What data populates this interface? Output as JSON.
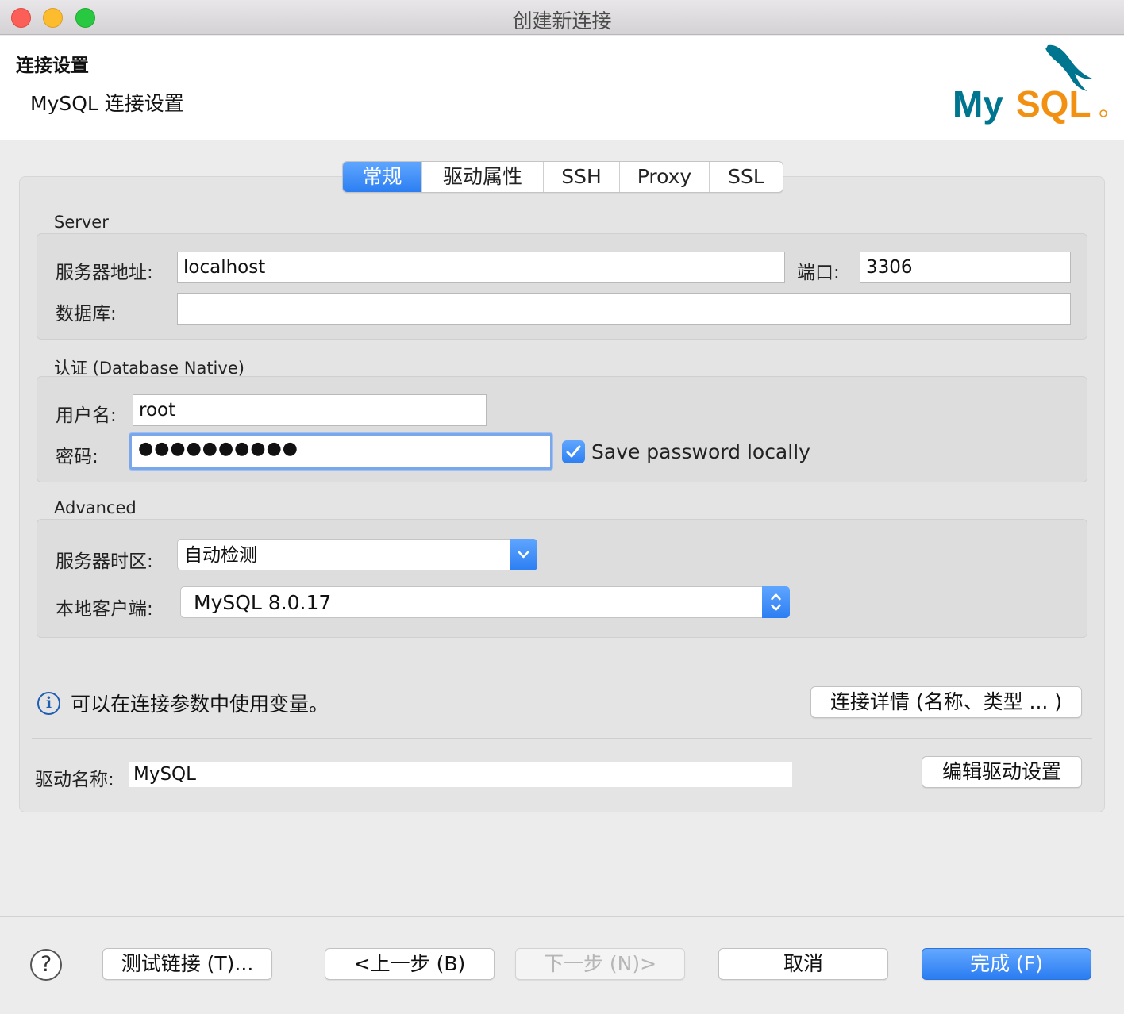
{
  "window": {
    "title": "创建新连接"
  },
  "header": {
    "title": "连接设置",
    "subtitle": "MySQL 连接设置",
    "logo": "MySQL"
  },
  "tabs": [
    {
      "label": "常规",
      "active": true
    },
    {
      "label": "驱动属性",
      "active": false
    },
    {
      "label": "SSH",
      "active": false
    },
    {
      "label": "Proxy",
      "active": false
    },
    {
      "label": "SSL",
      "active": false
    }
  ],
  "server": {
    "section": "Server",
    "host_label": "服务器地址:",
    "host_value": "localhost",
    "port_label": "端口:",
    "port_value": "3306",
    "database_label": "数据库:",
    "database_value": ""
  },
  "auth": {
    "section": "认证 (Database Native)",
    "user_label": "用户名:",
    "user_value": "root",
    "password_label": "密码:",
    "password_value": "●●●●●●●●●●",
    "save_password_label": "Save password locally",
    "save_password_checked": true
  },
  "advanced": {
    "section": "Advanced",
    "timezone_label": "服务器时区:",
    "timezone_value": "自动检测",
    "client_label": "本地客户端:",
    "client_value": "MySQL 8.0.17"
  },
  "info": {
    "text": "可以在连接参数中使用变量。",
    "details_button": "连接详情 (名称、类型 ... )"
  },
  "driver": {
    "label": "驱动名称:",
    "value": "MySQL",
    "edit_button": "编辑驱动设置"
  },
  "footer": {
    "help": "?",
    "test": "测试链接 (T)...",
    "back": "<上一步 (B)",
    "next": "下一步 (N)>",
    "cancel": "取消",
    "finish": "完成 (F)"
  },
  "colors": {
    "accent": "#2c7ef2",
    "mysql_teal": "#00758f",
    "mysql_orange": "#f29111"
  },
  "icons": {
    "info": "info-icon",
    "help": "question-icon",
    "dropdown": "chevron-down-icon",
    "stepper": "updown-icon",
    "check": "checkmark-icon"
  }
}
